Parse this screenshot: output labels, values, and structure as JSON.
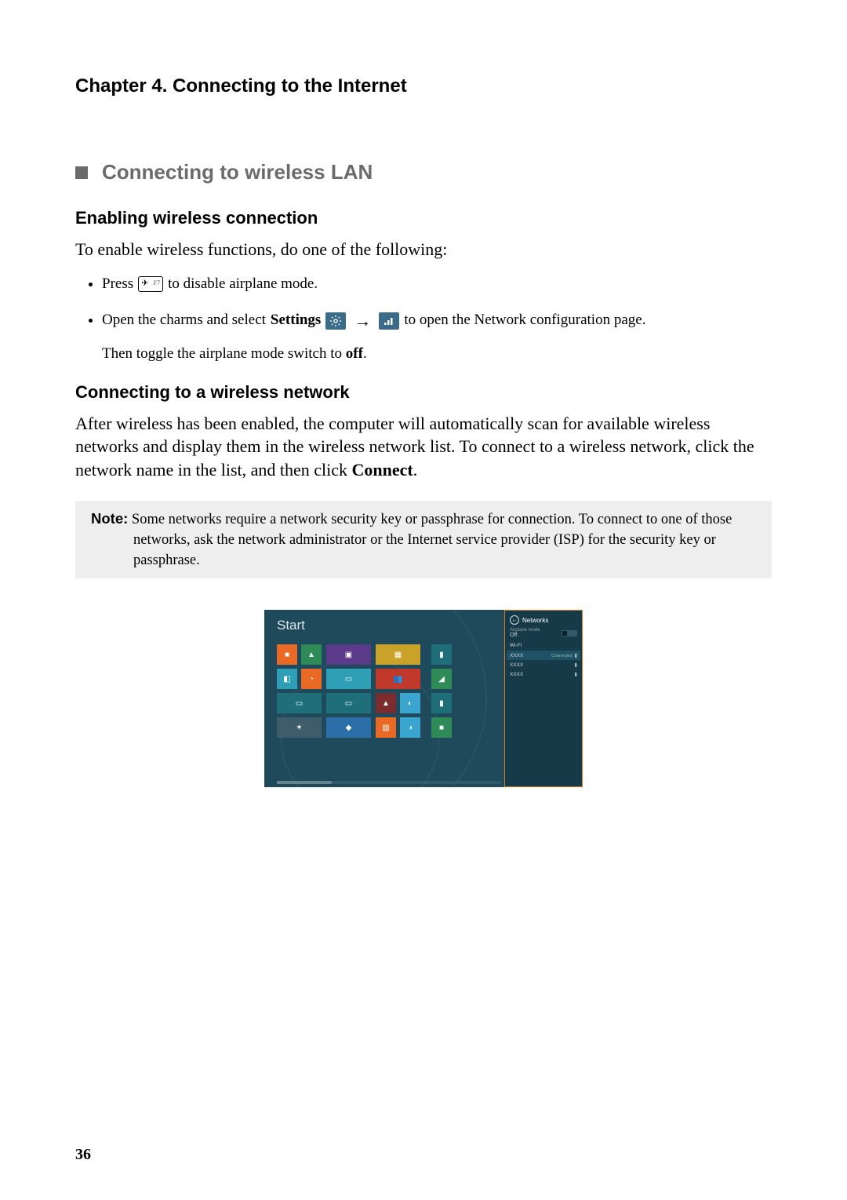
{
  "chapter": {
    "title": "Chapter 4. Connecting to the Internet"
  },
  "section": {
    "title": "Connecting to wireless LAN"
  },
  "sub1": {
    "heading": "Enabling wireless connection",
    "intro": "To enable wireless functions, do one of the following:",
    "b1_pre": "Press",
    "b1_post": "to disable airplane mode.",
    "key_f7": "F7",
    "b2_pre": "Open the charms and select",
    "b2_settings": "Settings",
    "b2_post": "to open the Network configuration page.",
    "then": "Then toggle the airplane mode switch to",
    "then_bold": "off",
    "then_period": "."
  },
  "sub2": {
    "heading": "Connecting to a wireless network",
    "para": "After wireless has been enabled, the computer will automatically scan for available wireless networks and display them in the wireless network list. To connect to a wireless network, click the network name in the list, and then click ",
    "para_bold": "Connect",
    "para_period": "."
  },
  "note": {
    "label": "Note:",
    "text": "Some networks require a network security key or passphrase for connection. To connect to one of those networks, ask the network administrator or the Internet service provider (ISP) for the security key or passphrase."
  },
  "figure": {
    "start_label": "Start",
    "net": {
      "title": "Networks",
      "airplane_label": "Airplane mode",
      "airplane_value": "Off",
      "wifi_label": "Wi-Fi",
      "items": [
        {
          "name": "XXXX",
          "status": "Connected"
        },
        {
          "name": "XXXX",
          "status": ""
        },
        {
          "name": "XXXX",
          "status": ""
        }
      ]
    }
  },
  "page_number": "36"
}
